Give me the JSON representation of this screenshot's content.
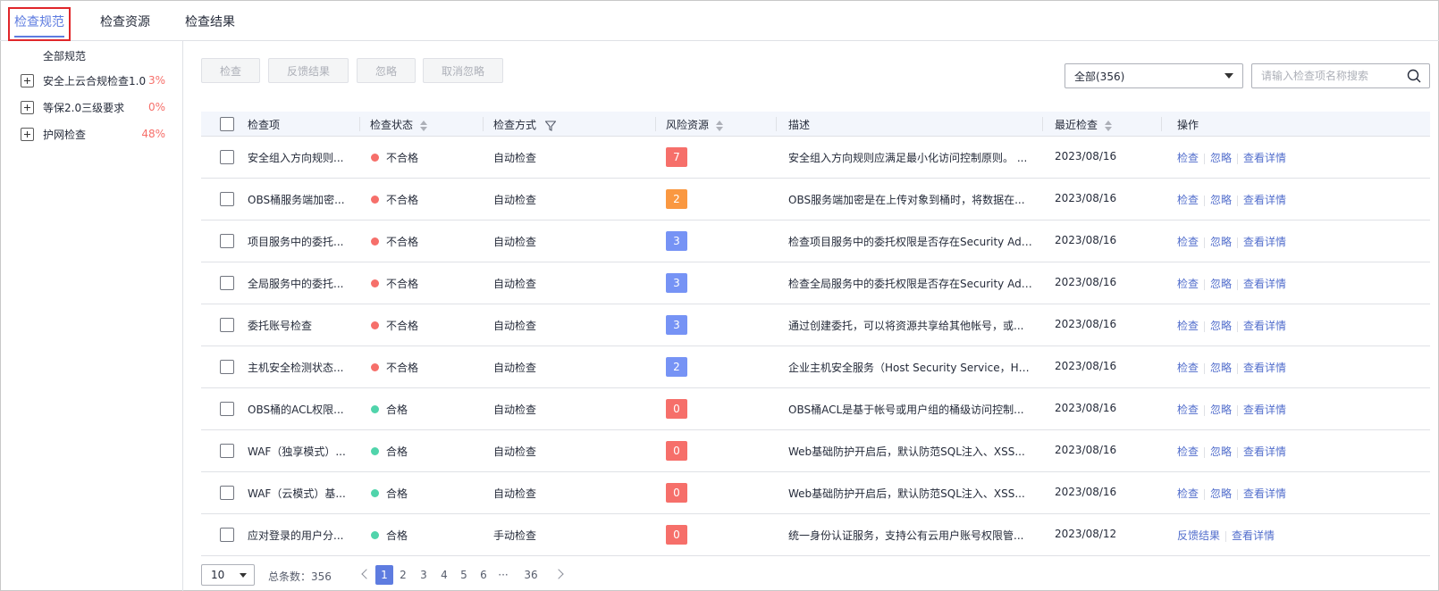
{
  "tabs": [
    {
      "label": "检查规范",
      "active": true
    },
    {
      "label": "检查资源",
      "active": false
    },
    {
      "label": "检查结果",
      "active": false
    }
  ],
  "sidebar": {
    "root": "全部规范",
    "items": [
      {
        "label": "安全上云合规检查1.0",
        "percent": "3%"
      },
      {
        "label": "等保2.0三级要求",
        "percent": "0%"
      },
      {
        "label": "护网检查",
        "percent": "48%"
      }
    ]
  },
  "toolbar": {
    "check": "检查",
    "feedback": "反馈结果",
    "ignore": "忽略",
    "unignore": "取消忽略"
  },
  "filter": {
    "selected": "全部(356)",
    "search_placeholder": "请输入检查项名称搜索"
  },
  "table": {
    "headers": {
      "name": "检查项",
      "status": "检查状态",
      "method": "检查方式",
      "risk": "风险资源",
      "desc": "描述",
      "last": "最近检查",
      "ops": "操作"
    },
    "rows": [
      {
        "name": "安全组入方向规则...",
        "status": "不合格",
        "method": "自动检查",
        "risk": "7",
        "desc": "安全组入方向规则应满足最小化访问控制原则。 ...",
        "last": "2023/08/16",
        "ops": [
          "检查",
          "忽略",
          "查看详情"
        ]
      },
      {
        "name": "OBS桶服务端加密...",
        "status": "不合格",
        "method": "自动检查",
        "risk": "2",
        "desc": "OBS服务端加密是在上传对象到桶时，将数据在...",
        "last": "2023/08/16",
        "ops": [
          "检查",
          "忽略",
          "查看详情"
        ]
      },
      {
        "name": "项目服务中的委托...",
        "status": "不合格",
        "method": "自动检查",
        "risk": "3",
        "desc": "检查项目服务中的委托权限是否存在Security Adm...",
        "last": "2023/08/16",
        "ops": [
          "检查",
          "忽略",
          "查看详情"
        ]
      },
      {
        "name": "全局服务中的委托...",
        "status": "不合格",
        "method": "自动检查",
        "risk": "3",
        "desc": "检查全局服务中的委托权限是否存在Security Adm...",
        "last": "2023/08/16",
        "ops": [
          "检查",
          "忽略",
          "查看详情"
        ]
      },
      {
        "name": "委托账号检查",
        "status": "不合格",
        "method": "自动检查",
        "risk": "3",
        "desc": "通过创建委托，可以将资源共享给其他帐号，或...",
        "last": "2023/08/16",
        "ops": [
          "检查",
          "忽略",
          "查看详情"
        ]
      },
      {
        "name": "主机安全检测状态...",
        "status": "不合格",
        "method": "自动检查",
        "risk": "2",
        "desc": "企业主机安全服务（Host Security Service，HSS...",
        "last": "2023/08/16",
        "ops": [
          "检查",
          "忽略",
          "查看详情"
        ]
      },
      {
        "name": "OBS桶的ACL权限...",
        "status": "合格",
        "method": "自动检查",
        "risk": "0",
        "desc": "OBS桶ACL是基于帐号或用户组的桶级访问控制...",
        "last": "2023/08/16",
        "ops": [
          "检查",
          "忽略",
          "查看详情"
        ]
      },
      {
        "name": "WAF（独享模式）...",
        "status": "合格",
        "method": "自动检查",
        "risk": "0",
        "desc": "Web基础防护开启后，默认防范SQL注入、XSS...",
        "last": "2023/08/16",
        "ops": [
          "检查",
          "忽略",
          "查看详情"
        ]
      },
      {
        "name": "WAF（云模式）基...",
        "status": "合格",
        "method": "自动检查",
        "risk": "0",
        "desc": "Web基础防护开启后，默认防范SQL注入、XSS...",
        "last": "2023/08/16",
        "ops": [
          "检查",
          "忽略",
          "查看详情"
        ]
      },
      {
        "name": "应对登录的用户分...",
        "status": "合格",
        "method": "手动检查",
        "risk": "0",
        "desc": "统一身份认证服务，支持公有云用户账号权限管...",
        "last": "2023/08/12",
        "ops": [
          "反馈结果",
          "查看详情"
        ]
      }
    ]
  },
  "pagination": {
    "page_size": "10",
    "total": "总条数：356",
    "pages": [
      "1",
      "2",
      "3",
      "4",
      "5",
      "6",
      "···",
      "36"
    ],
    "current": "1"
  },
  "colors": {
    "accent": "#5e7ce0",
    "fail": "#f66f6a",
    "pass": "#50d4ab",
    "risk_high": "#f66f6a",
    "risk_medium": "#fa9841",
    "risk_low": "#7693f5"
  }
}
